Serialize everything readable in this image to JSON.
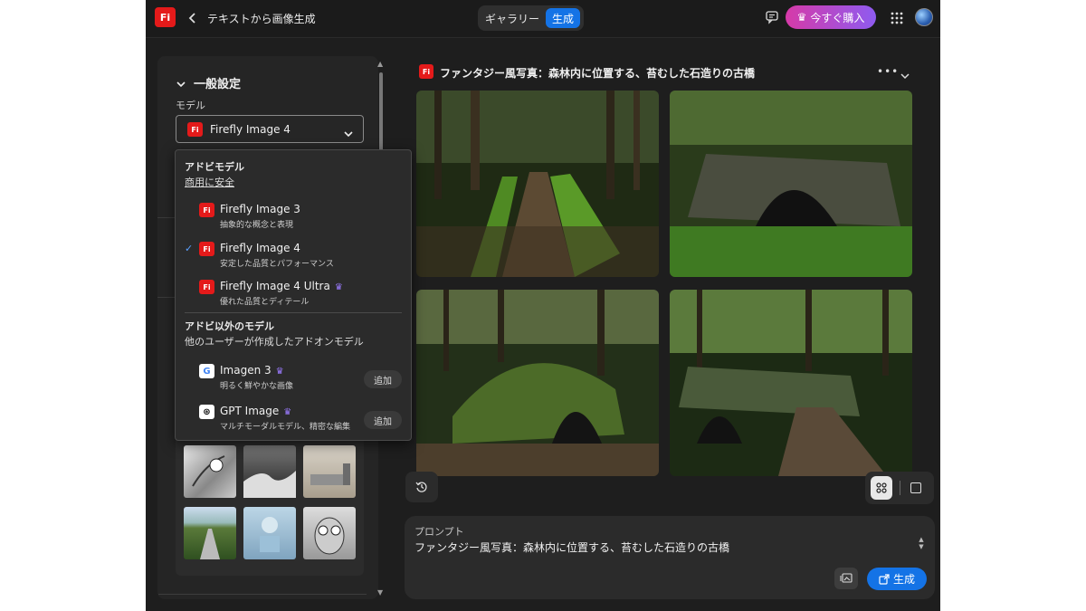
{
  "topbar": {
    "logo_text": "Fi",
    "back_icon": "chevron-left-icon",
    "title": "テキストから画像生成",
    "tab_gallery": "ギャラリー",
    "tab_generate": "生成",
    "buy_label": "今すぐ購入",
    "brand_color": "#e41a1a",
    "accent_color": "#1473e6"
  },
  "left_panel": {
    "section_title": "一般設定",
    "model_label": "モデル",
    "selected_model": "Firefly Image 4"
  },
  "dropdown": {
    "group1_title": "アドビモデル",
    "group1_subtitle": "商用に安全",
    "group2_title": "アドビ以外のモデル",
    "group2_subtitle": "他のユーザーが作成したアドオンモデル",
    "items": [
      {
        "name": "Firefly Image 3",
        "desc": "抽象的な概念と表現",
        "logo": "Fi"
      },
      {
        "name": "Firefly Image 4",
        "desc": "安定した品質とパフォーマンス",
        "logo": "Fi",
        "selected": true
      },
      {
        "name": "Firefly Image 4 Ultra",
        "desc": "優れた品質とディテール",
        "logo": "Fi",
        "premium": true
      },
      {
        "name": "Imagen 3",
        "desc": "明るく鮮やかな画像",
        "logo": "G",
        "premium": true,
        "action": "追加"
      },
      {
        "name": "GPT Image",
        "desc": "マルチモーダルモデル、精密な編集",
        "logo": "⊛",
        "premium": true,
        "action": "追加"
      }
    ]
  },
  "main": {
    "logo_text": "Fi",
    "title": "ファンタジー風写真：森林内に位置する、苔むした石造りの古橋",
    "more_icon": "more-horizontal-icon"
  },
  "prompt": {
    "label": "プロンプト",
    "text": "ファンタジー風写真：森林内に位置する、苔むした石造りの古橋",
    "generate_label": "生成"
  }
}
